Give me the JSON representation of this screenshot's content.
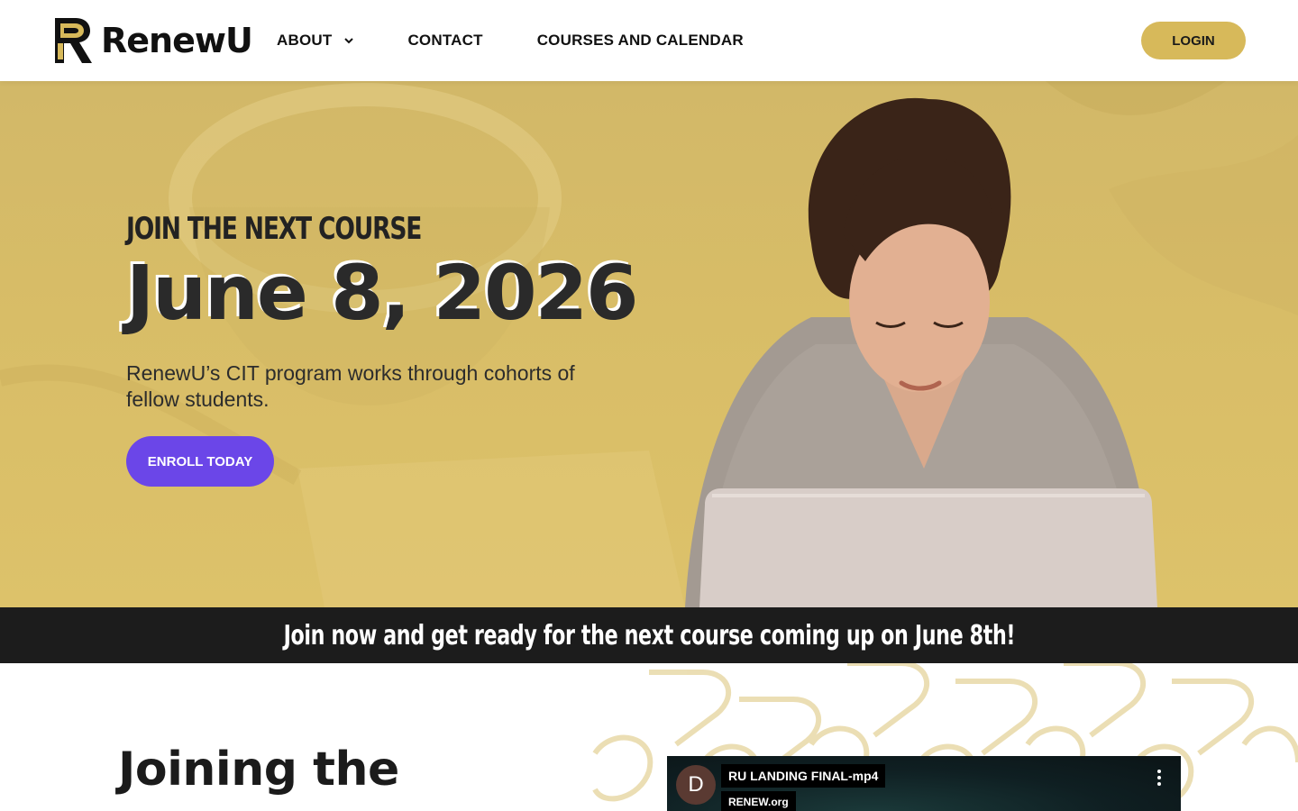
{
  "brand": {
    "name": "RenewU"
  },
  "nav": {
    "items": [
      {
        "label": "ABOUT",
        "has_dropdown": true
      },
      {
        "label": "CONTACT"
      },
      {
        "label": "COURSES AND CALENDAR"
      }
    ],
    "login_label": "LOGIN"
  },
  "hero": {
    "eyebrow": "JOIN THE NEXT COURSE",
    "date": "June 8, 2026",
    "description": "RenewU’s CIT program works through cohorts of fellow students.",
    "cta_label": "ENROLL TODAY"
  },
  "banner": {
    "text": "Join now and get ready for the next course coming up on June 8th!"
  },
  "section": {
    "title": "Joining the"
  },
  "video": {
    "avatar_letter": "D",
    "title": "RU LANDING FINAL-mp4",
    "channel": "RENEW.org"
  },
  "colors": {
    "gold": "#d7b95a",
    "hero_bg": "#d8bd67",
    "purple": "#6b46e8",
    "dark": "#1c1c1c"
  },
  "icons": [
    "renewu-logo-icon",
    "chevron-down-icon",
    "more-vert-icon"
  ]
}
